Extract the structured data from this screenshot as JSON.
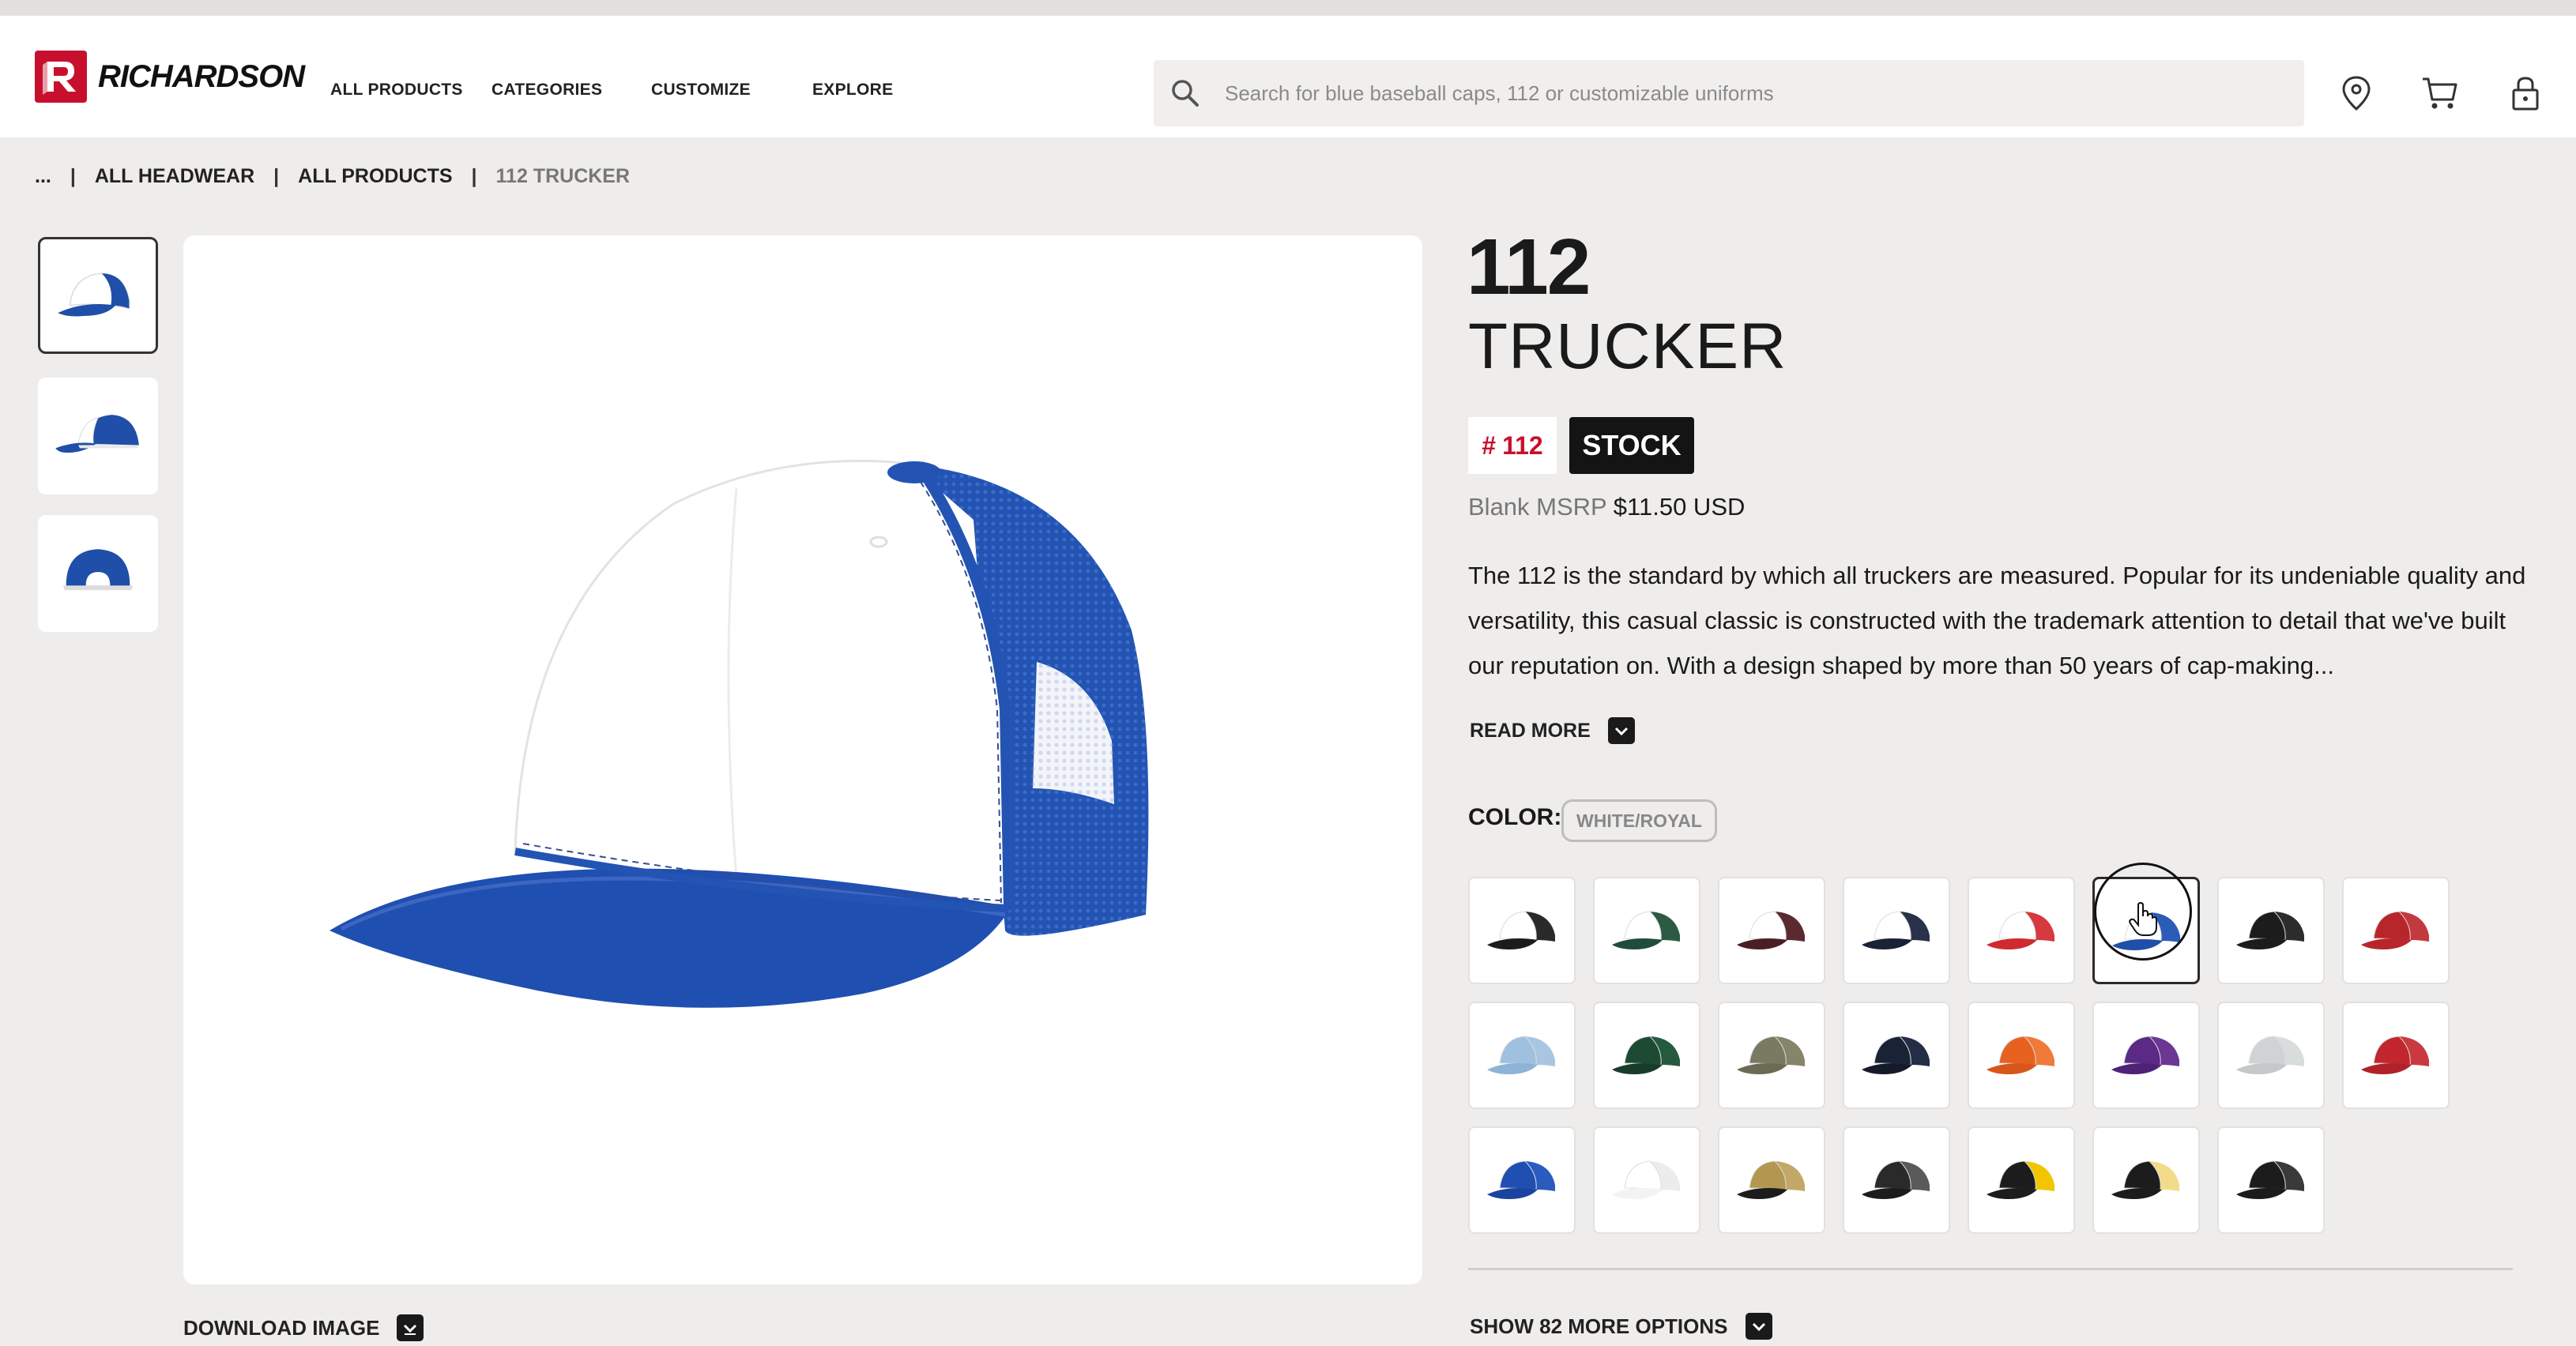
{
  "brand": {
    "name": "RICHARDSON",
    "logo_icon": "richardson-r-logo",
    "accent": "#c8102e"
  },
  "nav": {
    "items": [
      {
        "label": "ALL PRODUCTS"
      },
      {
        "label": "CATEGORIES"
      },
      {
        "label": "CUSTOMIZE"
      },
      {
        "label": "EXPLORE"
      }
    ]
  },
  "search": {
    "placeholder": "Search for blue baseball caps, 112 or customizable uniforms",
    "icon": "search-icon"
  },
  "header_icons": [
    "location-pin-icon",
    "cart-icon",
    "lock-icon"
  ],
  "breadcrumb": {
    "ellipsis": "...",
    "separator": "|",
    "items": [
      {
        "label": "ALL HEADWEAR"
      },
      {
        "label": "ALL PRODUCTS"
      },
      {
        "label": "112 TRUCKER"
      }
    ]
  },
  "gallery": {
    "thumbnails": [
      {
        "view": "front-three-quarter",
        "active": true
      },
      {
        "view": "side",
        "active": false
      },
      {
        "view": "back",
        "active": false
      }
    ],
    "download_label": "DOWNLOAD IMAGE"
  },
  "product": {
    "number": "112",
    "name": "TRUCKER",
    "sku_hash": "#",
    "sku": "112",
    "stock_label": "STOCK",
    "msrp_label": "Blank MSRP",
    "msrp_price": "$11.50 USD",
    "description": "The 112 is the standard by which all truckers are measured. Popular for its undeniable quality and versatility, this casual classic is constructed with the trademark attention to detail that we've built our reputation on. With a design shaped by more than 50 years of cap-making...",
    "read_more_label": "READ MORE"
  },
  "color": {
    "label": "COLOR:",
    "selected": "WHITE/ROYAL",
    "swatches": [
      {
        "front": "#ffffff",
        "bill": "#1c1c1c",
        "mesh": "#2a2a2a"
      },
      {
        "front": "#ffffff",
        "bill": "#1f4d3a",
        "mesh": "#2c5a45"
      },
      {
        "front": "#ffffff",
        "bill": "#4a1f24",
        "mesh": "#5a2a30"
      },
      {
        "front": "#ffffff",
        "bill": "#1a2236",
        "mesh": "#28324a"
      },
      {
        "front": "#ffffff",
        "bill": "#cf2a2f",
        "mesh": "#d63a3e"
      },
      {
        "front": "#ffffff",
        "bill": "#1f4fa8",
        "mesh": "#2a5cb8",
        "selected": true
      },
      {
        "front": "#1c1c1c",
        "bill": "#1c1c1c",
        "mesh": "#2c2c2c"
      },
      {
        "front": "#b8262b",
        "bill": "#b8262b",
        "mesh": "#c33a3e"
      },
      {
        "front": "#9fc0df",
        "bill": "#8fb3d6",
        "mesh": "#a8c6e2"
      },
      {
        "front": "#1e4a34",
        "bill": "#173c2a",
        "mesh": "#255a40"
      },
      {
        "front": "#7a7a62",
        "bill": "#6b6b55",
        "mesh": "#85856c"
      },
      {
        "front": "#1a2236",
        "bill": "#141a2a",
        "mesh": "#232d45"
      },
      {
        "front": "#e8621f",
        "bill": "#d9561a",
        "mesh": "#ef7a3a"
      },
      {
        "front": "#5b2a86",
        "bill": "#4e2276",
        "mesh": "#6a3795"
      },
      {
        "front": "#cfd3d3",
        "bill": "#c4c8c8",
        "mesh": "#d8dcdc"
      },
      {
        "front": "#c1272d",
        "bill": "#b02228",
        "mesh": "#c83a3f"
      },
      {
        "front": "#1f4fb0",
        "bill": "#1a44a0",
        "mesh": "#2a5cc0"
      },
      {
        "front": "#ffffff",
        "bill": "#f3f3f3",
        "mesh": "#ececec"
      },
      {
        "front": "#b39650",
        "bill": "#1c1c1c",
        "mesh": "#c2a868"
      },
      {
        "front": "#2a2a2a",
        "bill": "#1c1c1c",
        "mesh": "#5a5a5a"
      },
      {
        "front": "#1c1c1c",
        "bill": "#1c1c1c",
        "mesh": "#f2c500"
      },
      {
        "front": "#1c1c1c",
        "bill": "#1c1c1c",
        "mesh": "#f2dc8a"
      },
      {
        "front": "#1c1c1c",
        "bill": "#1c1c1c",
        "mesh": "#3a3a3a"
      }
    ],
    "more_options_label": "SHOW 82 MORE OPTIONS"
  }
}
